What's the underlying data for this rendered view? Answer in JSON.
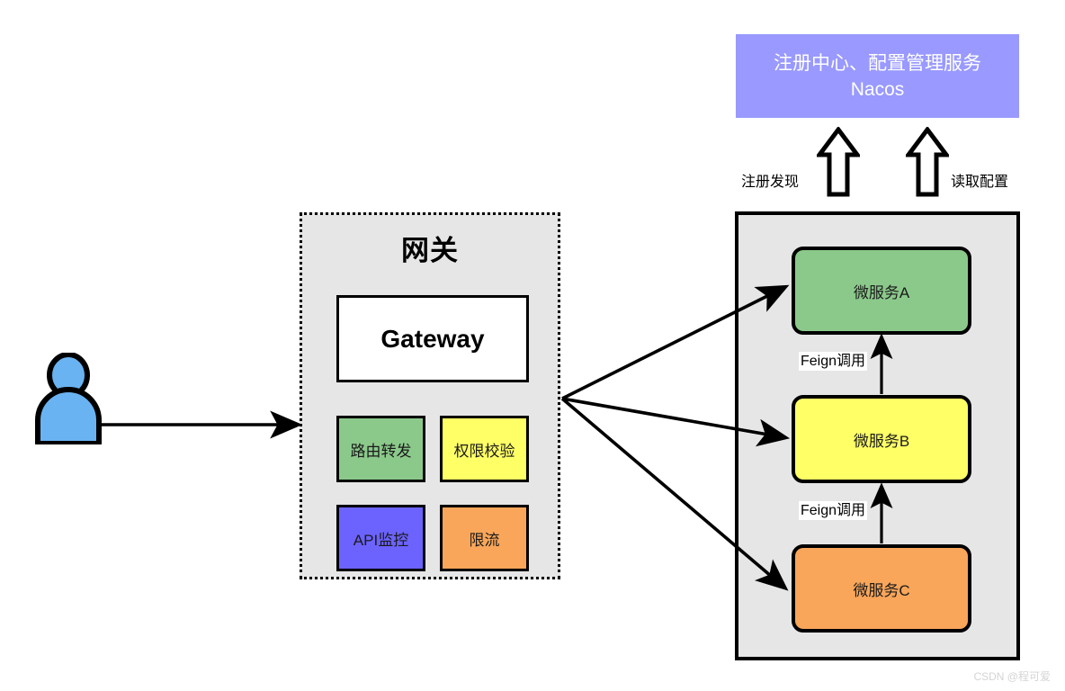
{
  "registry": {
    "line1": "注册中心、配置管理服务",
    "line2": "Nacos",
    "color": "#9999ff",
    "text_color": "#ffffff"
  },
  "registry_arrows": [
    {
      "label": "注册发现",
      "icon": "up-block-arrow"
    },
    {
      "label": "读取配置",
      "icon": "up-block-arrow"
    }
  ],
  "gateway": {
    "title": "网关",
    "main_label": "Gateway",
    "features": [
      {
        "label": "路由转发",
        "color": "#8bc98b"
      },
      {
        "label": "权限校验",
        "color": "#ffff66"
      },
      {
        "label": "API监控",
        "color": "#6c63ff"
      },
      {
        "label": "限流",
        "color": "#f9a65a"
      }
    ]
  },
  "services": {
    "items": [
      {
        "label": "微服务A",
        "color": "#8bc98b"
      },
      {
        "label": "微服务B",
        "color": "#ffff66"
      },
      {
        "label": "微服务C",
        "color": "#f9a65a"
      }
    ],
    "internal_calls": [
      {
        "label": "Feign调用",
        "from": "微服务B",
        "to": "微服务A"
      },
      {
        "label": "Feign调用",
        "from": "微服务C",
        "to": "微服务B"
      }
    ]
  },
  "actor": {
    "name": "user-actor",
    "color": "#69b3f2"
  },
  "watermark": {
    "text": "CSDN @程可爱"
  }
}
